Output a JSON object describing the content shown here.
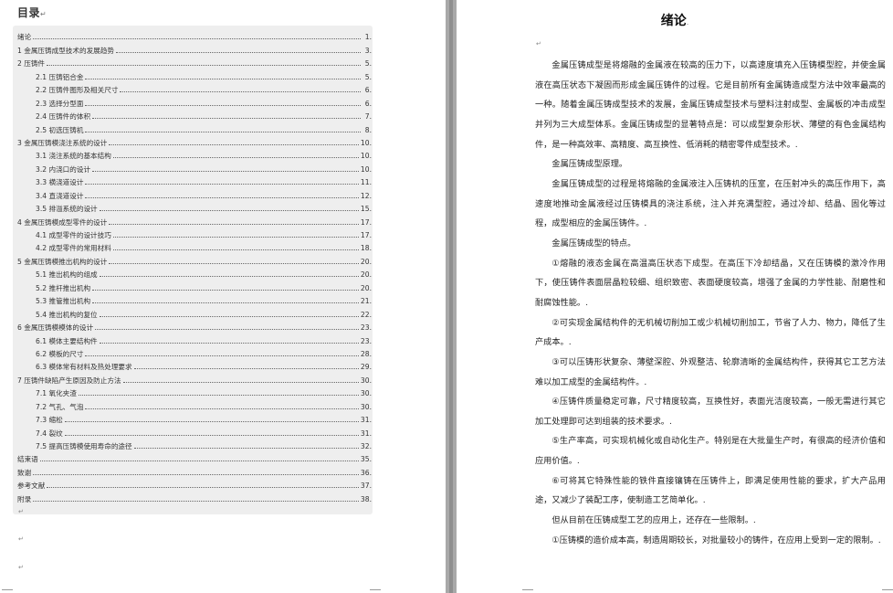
{
  "toc": {
    "title": "目录",
    "title_mark": "↵",
    "entries": [
      {
        "label": "绪论",
        "page": "1.",
        "level": 1
      },
      {
        "label": "1  金属压铸成型技术的发展趋势",
        "page": "3.",
        "level": 1
      },
      {
        "label": "2  压铸件",
        "page": "5.",
        "level": 1
      },
      {
        "label": "2.1  压铸铝合金",
        "page": "5.",
        "level": 2
      },
      {
        "label": "2.2  压铸件图形及相关尺寸",
        "page": "6.",
        "level": 2
      },
      {
        "label": "2.3  选择分型面",
        "page": "6.",
        "level": 2
      },
      {
        "label": "2.4  压铸件的体积",
        "page": "7.",
        "level": 2
      },
      {
        "label": "2.5  初选压铸机",
        "page": "8.",
        "level": 2
      },
      {
        "label": "3  金属压铸模浇注系统的设计",
        "page": "10.",
        "level": 1
      },
      {
        "label": "3.1  浇注系统的基本结构",
        "page": "10.",
        "level": 2
      },
      {
        "label": "3.2  内浇口的设计",
        "page": "10.",
        "level": 2
      },
      {
        "label": "3.3  横浇道设计",
        "page": "11.",
        "level": 2
      },
      {
        "label": "3.4  直浇道设计",
        "page": "12.",
        "level": 2
      },
      {
        "label": "3.5 排溢系统的设计",
        "page": "15.",
        "level": 2
      },
      {
        "label": "4  金属压铸模成型零件的设计",
        "page": "17.",
        "level": 1
      },
      {
        "label": "4.1  成型零件的设计技巧",
        "page": "17.",
        "level": 2
      },
      {
        "label": "4.2  成型零件的常用材料",
        "page": "18.",
        "level": 2
      },
      {
        "label": "5  金属压铸模推出机构的设计",
        "page": "20.",
        "level": 1
      },
      {
        "label": "5.1  推出机构的组成",
        "page": "20.",
        "level": 2
      },
      {
        "label": "5.2  推杆推出机构",
        "page": "20.",
        "level": 2
      },
      {
        "label": "5.3  推管推出机构",
        "page": "21.",
        "level": 2
      },
      {
        "label": "5.4  推出机构的复位",
        "page": "22.",
        "level": 2
      },
      {
        "label": "6  金属压铸模模体的设计",
        "page": "23.",
        "level": 1
      },
      {
        "label": "6.1  模体主要结构件",
        "page": "23.",
        "level": 2
      },
      {
        "label": "6.2  模板的尺寸",
        "page": "28.",
        "level": 2
      },
      {
        "label": "6.3  模体常有材料及热处理要求",
        "page": "29.",
        "level": 2
      },
      {
        "label": "7  压铸件缺陷产生原因及防止方法",
        "page": "30.",
        "level": 1
      },
      {
        "label": "7.1  氧化夹渣",
        "page": "30.",
        "level": 2
      },
      {
        "label": "7.2  气孔、气泡",
        "page": "30.",
        "level": 2
      },
      {
        "label": "7.3  缩松",
        "page": "31.",
        "level": 2
      },
      {
        "label": "7.4  裂纹",
        "page": "31.",
        "level": 2
      },
      {
        "label": "7.5 提高压铸模使用寿命的途径",
        "page": "32.",
        "level": 2
      },
      {
        "label": "结束语",
        "page": "35.",
        "level": 1
      },
      {
        "label": "致谢",
        "page": "36.",
        "level": 1
      },
      {
        "label": "参考文献",
        "page": "37.",
        "level": 1
      },
      {
        "label": "附录",
        "page": "38.",
        "level": 1
      }
    ],
    "marks": [
      "↵",
      "↵",
      "↵"
    ]
  },
  "document": {
    "title": "绪论",
    "title_mark": ".",
    "blank_mark": "↵",
    "paragraphs": [
      "金属压铸成型是将熔融的金属液在较高的压力下，以高速度填充入压铸模型腔，并使金属液在高压状态下凝固而形成金属压铸件的过程。它是目前所有金属铸造成型方法中效率最高的一种。随着金属压铸成型技术的发展，金属压铸成型技术与塑料注射成型、金属板的冲击成型并列为三大成型体系。金属压铸成型的显著特点是：可以成型复杂形状、薄壁的有色金属结构件，是一种高效率、高精度、高互换性、低消耗的精密零件成型技术。.",
      "金属压铸成型原理。",
      "金属压铸成型的过程是将熔融的金属液注入压铸机的压室，在压射冲头的高压作用下，高速度地推动金属液经过压铸模具的浇注系统，注入并充满型腔，通过冷却、结晶、固化等过程，成型相应的金属压铸件。.",
      "金属压铸成型的特点。",
      "①熔融的液态金属在高温高压状态下成型。在高压下冷却结晶，又在压铸模的激冷作用下，使压铸件表面层晶粒较细、组织致密、表面硬度较高，增强了金属的力学性能、耐磨性和耐腐蚀性能。.",
      "②可实现金属结构件的无机械切削加工或少机械切削加工，节省了人力、物力，降低了生产成本。.",
      "③可以压铸形状复杂、薄壁深腔、外观整洁、轮廓清晰的金属结构件，获得其它工艺方法难以加工成型的金属结构件。.",
      "④压铸件质量稳定可靠，尺寸精度较高，互换性好，表面光洁度较高，一般无需进行其它加工处理即可达到组装的技术要求。.",
      "⑤生产率高，可实现机械化或自动化生产。特别是在大批量生产时，有很高的经济价值和应用价值。.",
      "⑥可将其它特殊性能的铁件直接镶铸在压铸件上，即满足使用性能的要求，扩大产品用途，又减少了装配工序，使制造工艺简单化。.",
      "但从目前在压铸成型工艺的应用上，还存在一些限制。.",
      "①压铸模的造价成本高，制造周期较长，对批量较小的铸件，在应用上受到一定的限制。."
    ]
  }
}
